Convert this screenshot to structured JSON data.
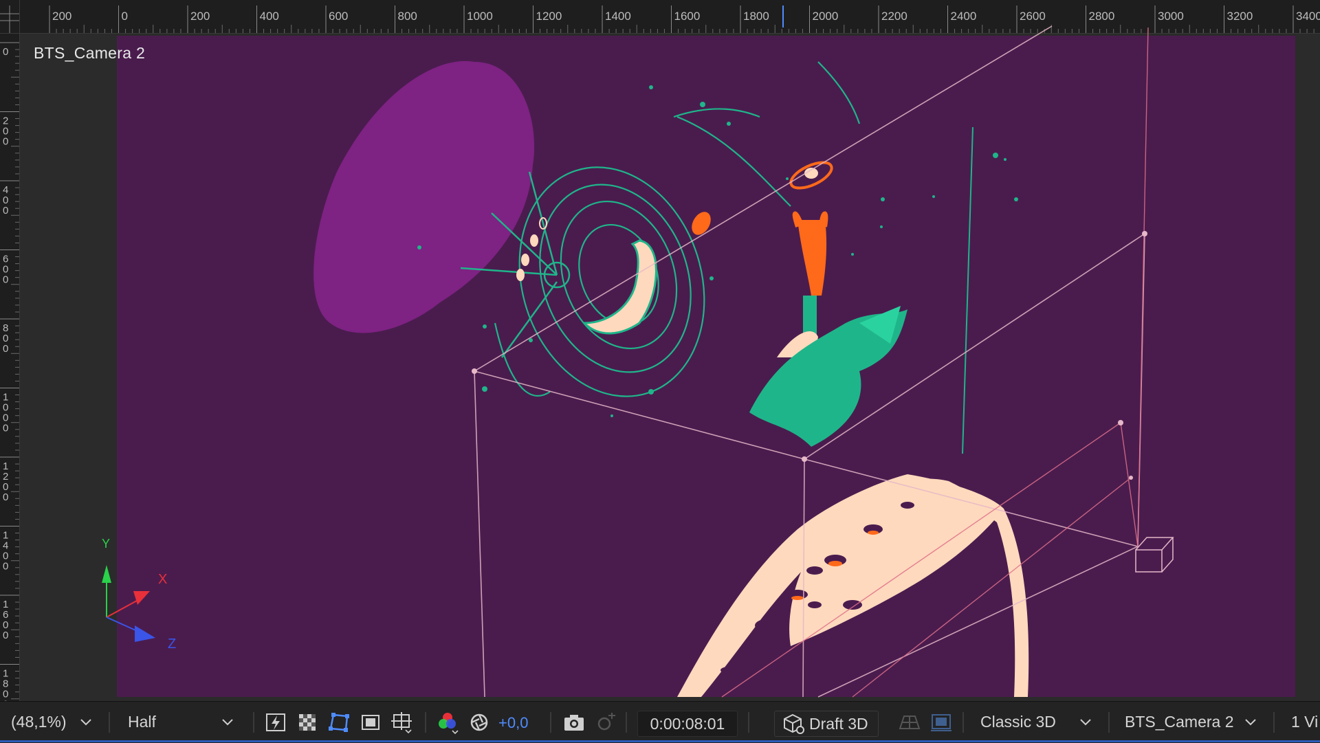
{
  "viewer": {
    "view_name": "BTS_Camera 2",
    "background_color": "#4a1c4e",
    "accent_colors": {
      "wireframe": "#e6b8c8",
      "camera_frustum": "#e0708a",
      "teal": "#1fb58a",
      "orange": "#ff6a1a",
      "cream": "#ffd9bd",
      "purple_blob": "#7e2283"
    }
  },
  "rulers": {
    "horizontal_labels": [
      "200",
      "0",
      "200",
      "400",
      "600",
      "800",
      "1000",
      "1200",
      "1400",
      "1600",
      "1800",
      "2000",
      "2200",
      "2400",
      "2600",
      "2800",
      "3000",
      "3200",
      "3400"
    ],
    "vertical_labels": [
      "0",
      "200",
      "400",
      "600",
      "800",
      "1000",
      "1200",
      "1400",
      "1600",
      "1800"
    ]
  },
  "axis_gizmo": {
    "y_label": "Y",
    "x_label": "X",
    "z_label": "Z"
  },
  "toolbar": {
    "magnification": "(48,1%)",
    "resolution": "Half",
    "exposure": "+0,0",
    "timecode": "0:00:08:01",
    "draft_3d": "Draft 3D",
    "renderer": "Classic 3D",
    "active_camera": "BTS_Camera 2",
    "views": "1 Vi",
    "icons": {
      "fast_previews": "lightning-icon",
      "transparency_grid": "checkerboard-icon",
      "mask_visibility": "mask-path-icon",
      "region_of_interest": "region-of-interest-icon",
      "grid_guides": "grid-guides-icon",
      "channels": "rgb-channels-icon",
      "color_management": "aperture-icon",
      "snapshot": "camera-snapshot-icon",
      "show_snapshot": "show-snapshot-icon",
      "draft3d": "cube-icon",
      "ground_plane": "ground-plane-icon",
      "extended_viewer": "extended-viewer-icon"
    }
  }
}
